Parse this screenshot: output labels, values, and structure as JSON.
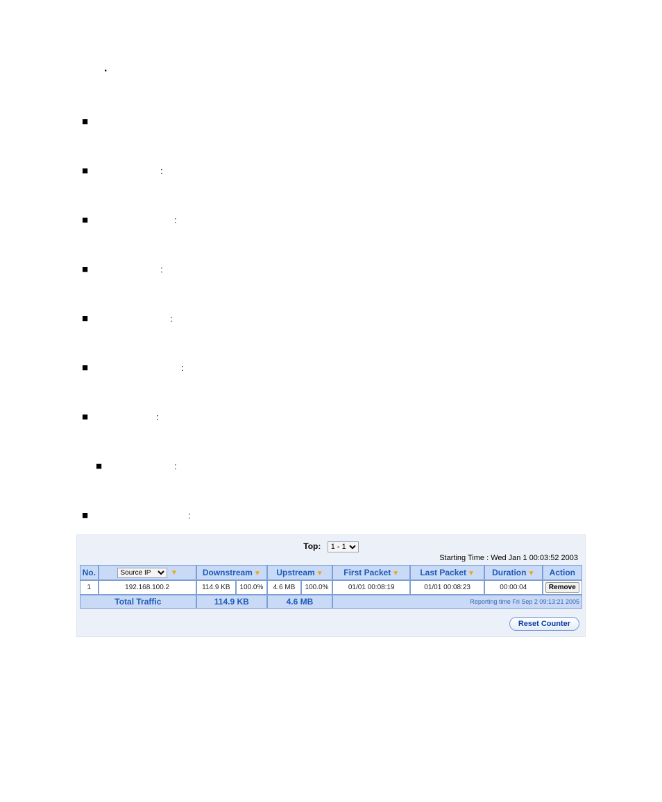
{
  "section_marker": ".",
  "bullets": [
    {
      "label": ""
    },
    {
      "label": "",
      "colon": ":"
    },
    {
      "label": "",
      "colon": ":"
    },
    {
      "label": "",
      "colon": ":"
    },
    {
      "label": "",
      "colon": ":"
    },
    {
      "label": "",
      "colon": ":"
    },
    {
      "label": "",
      "colon": ":"
    },
    {
      "label": "",
      "colon": ":"
    },
    {
      "label": "",
      "colon": ":"
    }
  ],
  "panel": {
    "top_label": "Top:",
    "top_select": "1 - 1",
    "starting_time_label": "Starting Time :",
    "starting_time_value": "Wed Jan 1 00:03:52 2003",
    "headers": {
      "no": "No.",
      "source_select": "Source IP",
      "downstream": "Downstream",
      "upstream": "Upstream",
      "first_packet": "First Packet",
      "last_packet": "Last Packet",
      "duration": "Duration",
      "action": "Action"
    },
    "rows": [
      {
        "no": "1",
        "source": "192.168.100.2",
        "down_size": "114.9 KB",
        "down_pct": "100.0%",
        "up_size": "4.6 MB",
        "up_pct": "100.0%",
        "first_packet": "01/01 00:08:19",
        "last_packet": "01/01 00:08:23",
        "duration": "00:00:04",
        "action": "Remove"
      }
    ],
    "total": {
      "label": "Total Traffic",
      "down": "114.9 KB",
      "up": "4.6 MB",
      "report_time": "Reporting time Fri Sep 2 09:13:21 2005"
    },
    "reset_btn": "Reset Counter"
  }
}
